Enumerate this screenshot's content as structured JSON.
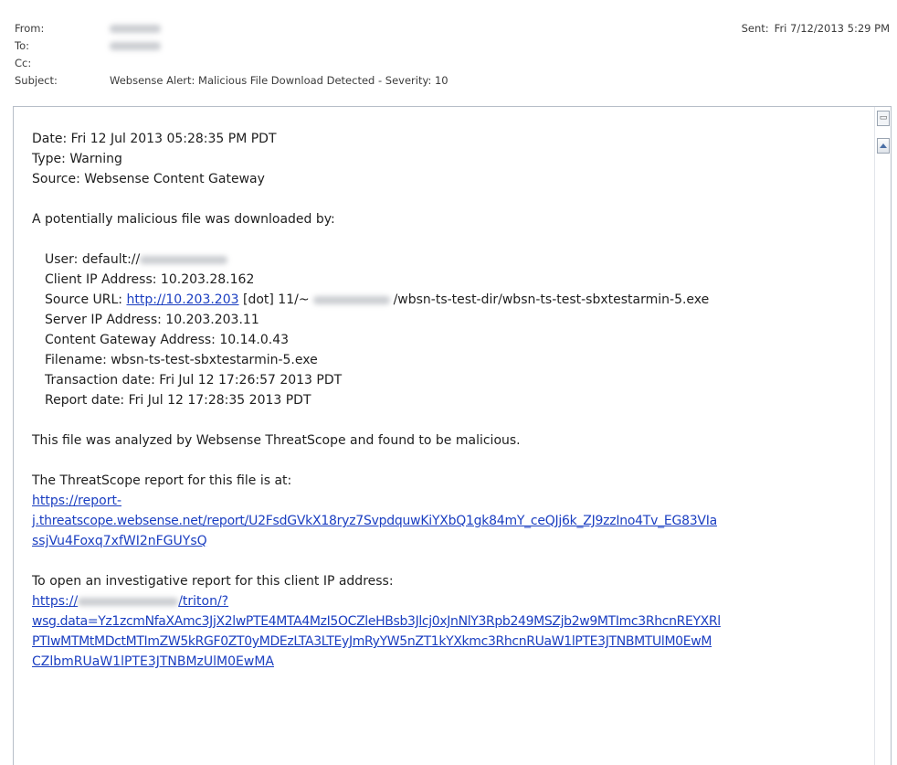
{
  "header": {
    "from_label": "From:",
    "to_label": "To:",
    "cc_label": "Cc:",
    "subject_label": "Subject:",
    "subject": "Websense Alert: Malicious File Download Detected - Severity: 10",
    "sent_label": "Sent:",
    "sent_value": "Fri 7/12/2013 5:29 PM"
  },
  "body": {
    "date": "Date: Fri 12 Jul 2013 05:28:35 PM PDT",
    "type": "Type: Warning",
    "source": "Source: Websense Content Gateway",
    "intro": "A potentially malicious file was downloaded by:",
    "user_prefix": "User: default://",
    "client_ip": "Client IP Address: 10.203.28.162",
    "source_url_prefix": "Source URL: ",
    "source_url_link": "http://10.203.203",
    "source_url_mid": " [dot] 11/~",
    "source_url_suffix": "/wbsn-ts-test-dir/wbsn-ts-test-sbxtestarmin-5.exe",
    "server_ip": "Server IP Address: 10.203.203.11",
    "gateway_ip": "Content Gateway Address: 10.14.0.43",
    "filename": "Filename: wbsn-ts-test-sbxtestarmin-5.exe",
    "transaction_date": "Transaction date: Fri Jul 12 17:26:57 2013 PDT",
    "report_date": "Report date: Fri Jul 12 17:28:35 2013 PDT",
    "analysis": "This file was analyzed by Websense ThreatScope and found to be malicious.",
    "report_intro": "The ThreatScope report for this file is at:",
    "report_link_1": "https://report-",
    "report_link_2": "j.threatscope.websense.net/report/U2FsdGVkX18ryz7SvpdquwKiYXbQ1gk84mY_ceQJj6k_ZJ9zzIno4Tv_EG83VIa",
    "report_link_3": "ssjVu4Foxq7xfWI2nFGUYsQ",
    "investigate_intro": "To open an investigative report for this client IP address:",
    "inv_link_1_prefix": "https://",
    "inv_link_1_suffix": "/triton/?",
    "inv_link_2": "wsg.data=Yz1zcmNfaXAmc3JjX2lwPTE4MTA4MzI5OCZleHBsb3Jlcj0xJnNlY3Rpb249MSZjb2w9MTImc3RhcnREYXRl",
    "inv_link_3": "PTIwMTMtMDctMTImZW5kRGF0ZT0yMDEzLTA3LTEyJmRyYW5nZT1kYXkmc3RhcnRUaW1lPTE3JTNBMTUlM0EwM",
    "inv_link_4": "CZlbmRUaW1lPTE3JTNBMzUlM0EwMA"
  }
}
